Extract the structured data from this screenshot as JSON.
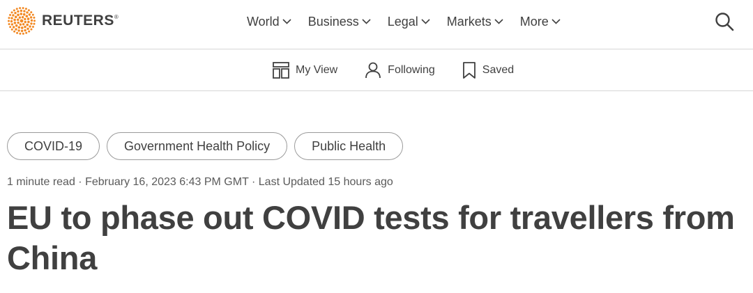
{
  "brand": {
    "name": "REUTERS",
    "trademark": "®"
  },
  "main_nav": [
    {
      "label": "World"
    },
    {
      "label": "Business"
    },
    {
      "label": "Legal"
    },
    {
      "label": "Markets"
    },
    {
      "label": "More"
    }
  ],
  "sub_nav": [
    {
      "label": "My View",
      "icon": "my-view-icon"
    },
    {
      "label": "Following",
      "icon": "person-icon"
    },
    {
      "label": "Saved",
      "icon": "bookmark-icon"
    }
  ],
  "article": {
    "tags": [
      "COVID-19",
      "Government Health Policy",
      "Public Health"
    ],
    "meta": {
      "read_time": "1 minute read",
      "published": "February 16, 2023 6:43 PM GMT",
      "updated": "Last Updated 15 hours ago",
      "separator": " · "
    },
    "headline": "EU to phase out COVID tests for travellers from China"
  },
  "colors": {
    "brand_orange": "#f28a25",
    "text": "#404040",
    "border": "#d6d6d6"
  }
}
